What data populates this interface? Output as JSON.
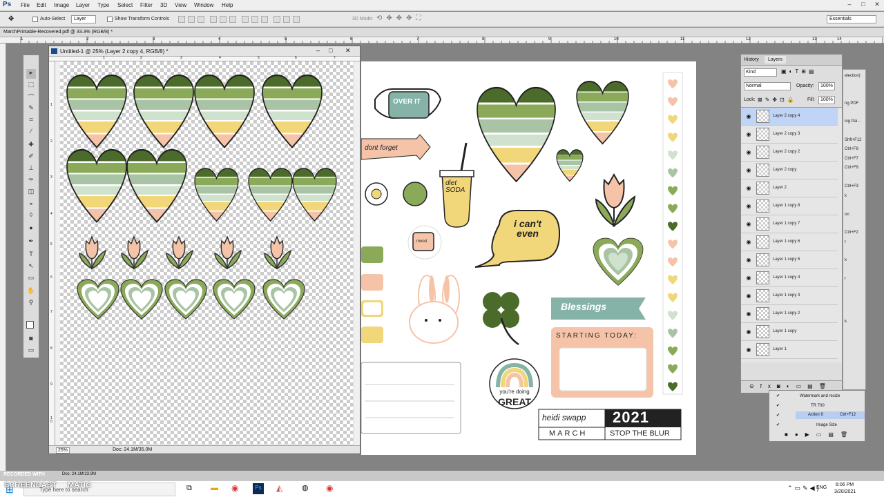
{
  "app": {
    "logo": "Ps"
  },
  "menu": [
    "File",
    "Edit",
    "Image",
    "Layer",
    "Type",
    "Select",
    "Filter",
    "3D",
    "View",
    "Window",
    "Help"
  ],
  "options": {
    "auto_select_label": "Auto-Select",
    "auto_select_value": "Layer",
    "transform_label": "Show Transform Controls",
    "mode_3d_label": "3D Mode:",
    "workspace": "Essentials"
  },
  "doc_tab": {
    "title": "MarchPrintable-Recovered.pdf @ 33.3% (RGB/8) *"
  },
  "window1": {
    "title": "Untitled-1 @ 25% (Layer 2 copy 4, RGB/8) *",
    "zoom": "25%",
    "doc_size": "Doc: 24.1M/35.0M"
  },
  "ruler1_v": [
    "1",
    "2",
    "3",
    "4",
    "5",
    "6",
    "7",
    "8",
    "9",
    "1\n0"
  ],
  "ruler1_h": [
    "1",
    "2",
    "3",
    "4",
    "5",
    "6",
    "7"
  ],
  "ruler_top": [
    "1",
    "2",
    "3",
    "4",
    "5",
    "6",
    "7",
    "8",
    "9",
    "10",
    "11",
    "12",
    "13",
    "14"
  ],
  "stickers": {
    "over_it": "OVER IT",
    "dont_forget": "dont forget",
    "diet_soda": "diet SODA",
    "cant_even": "i can't even",
    "mood": "mood",
    "blessings": "Blessings",
    "starting_today": "STARTING TODAY:",
    "youre_doing": "you're doing",
    "great": "GREAT",
    "brand": "heidi swapp",
    "year": "2021",
    "month": "MARCH",
    "tagline": "STOP THE BLUR"
  },
  "panel": {
    "tab_history": "History",
    "tab_layers": "Layers",
    "kind": "Kind",
    "blend": "Normal",
    "opacity_label": "Opacity:",
    "opacity": "100%",
    "lock_label": "Lock:",
    "fill_label": "Fill:",
    "fill": "100%",
    "layers": [
      "Layer 2 copy 4",
      "Layer 2 copy 3",
      "Layer 2 copy 2",
      "Layer 2 copy",
      "Layer 2",
      "Layer 1 copy 8",
      "Layer 1 copy 7",
      "Layer 1 copy 6",
      "Layer 1 copy 5",
      "Layer 1 copy 4",
      "Layer 1 copy 3",
      "Layer 1 copy 2",
      "Layer 1 copy",
      "Layer 1"
    ]
  },
  "right_strip": [
    "election)",
    "ng PDF",
    "ing Pai...",
    "Shft+F12",
    "Ctrl+F8",
    "Ctrl+F7",
    "Ctrl+F9",
    "Ctrl+F3",
    "k",
    "on",
    "Ctrl+F2",
    "r",
    "k",
    "r",
    "k"
  ],
  "actions": {
    "items": [
      "Watermark and resize",
      "TR 700",
      "Action 9",
      "Image Size"
    ],
    "shortcut": "Ctrl+F12"
  },
  "statusbar": {
    "recorded": "RECORDED WITH",
    "brand": "SCREENCAST",
    "brand2": "MATIC",
    "doc": "Doc: 24.1M/23.9M"
  },
  "taskbar": {
    "search": "Type here to search",
    "lang": "ENG",
    "time": "6:06 PM",
    "date": "3/20/2021"
  },
  "colors": {
    "green_dark": "#4b6b2a",
    "green_mid": "#8aaa5a",
    "sage": "#a9c4a4",
    "mint": "#cfe2cd",
    "yellow": "#f2d67a",
    "peach": "#f5c4a8",
    "teal": "#86b3a8"
  }
}
